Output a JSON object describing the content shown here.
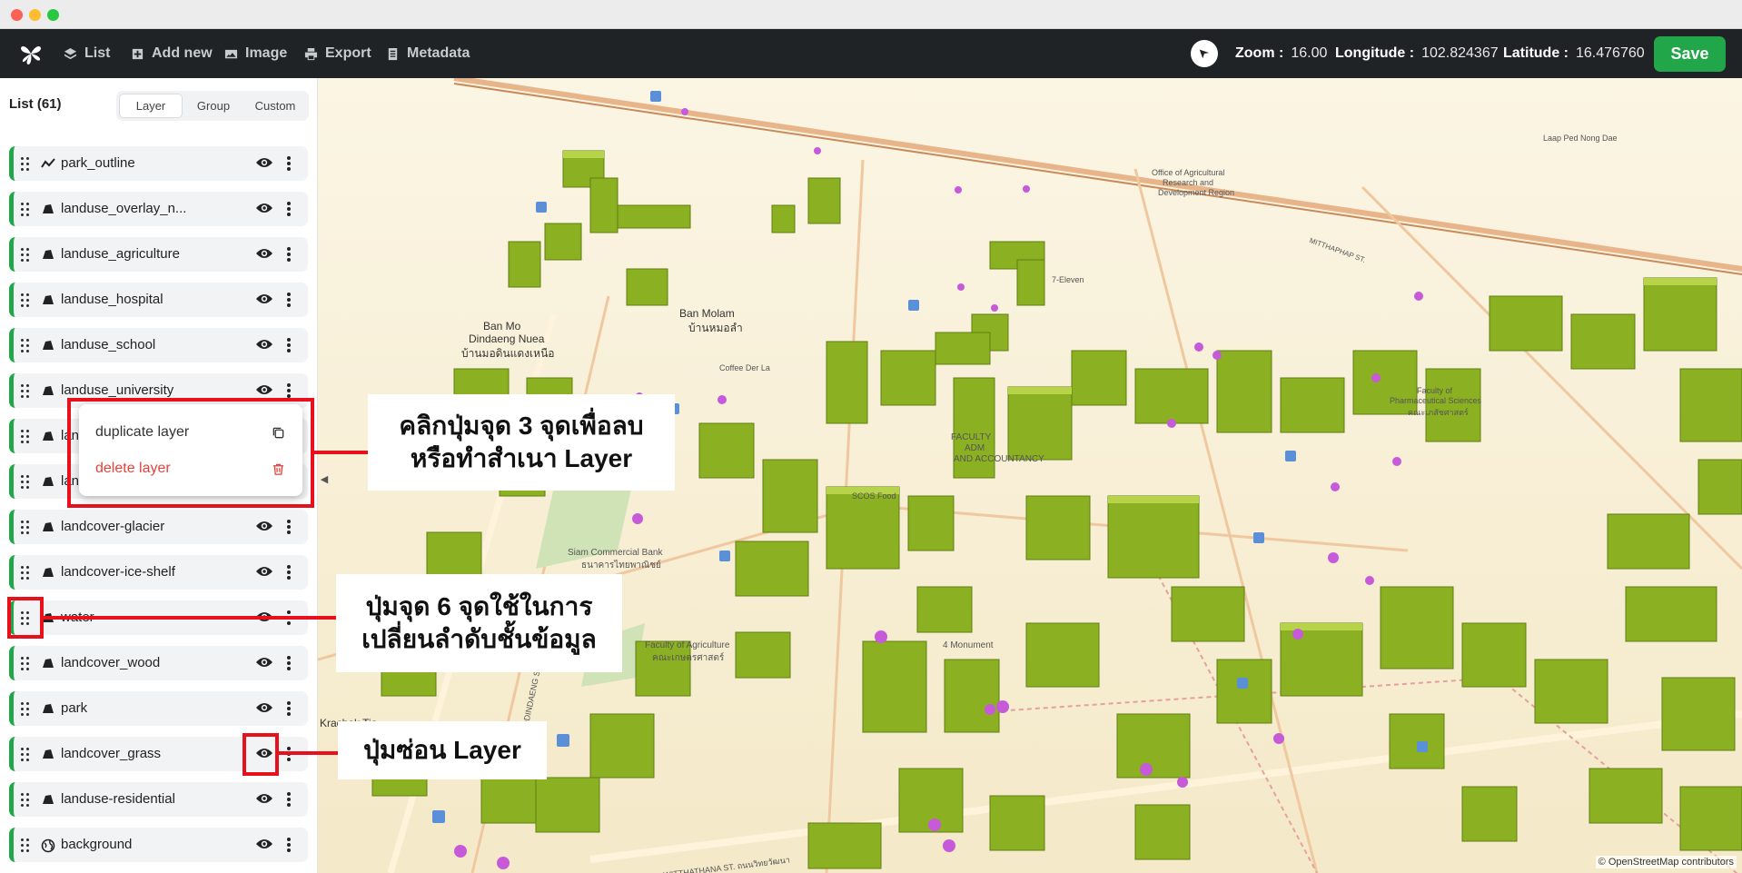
{
  "window": {
    "controls": [
      "close",
      "minimize",
      "maximize"
    ]
  },
  "toolbar": {
    "logo_icon": "leaf-logo-icon",
    "items": [
      {
        "label": "List",
        "icon": "layers-icon"
      },
      {
        "label": "Add new",
        "icon": "plus-square-icon"
      },
      {
        "label": "Image",
        "icon": "image-icon"
      },
      {
        "label": "Export",
        "icon": "printer-icon"
      },
      {
        "label": "Metadata",
        "icon": "document-icon"
      }
    ],
    "zoom_label": "Zoom :",
    "zoom_value": "16.00",
    "longitude_label": "Longitude :",
    "longitude_value": "102.824367",
    "latitude_label": "Latitude :",
    "latitude_value": "16.476760",
    "save_label": "Save"
  },
  "sidebar": {
    "title": "List (61)",
    "tabs": [
      "Layer",
      "Group",
      "Custom"
    ],
    "active_tab": "Layer",
    "layers": [
      {
        "name": "park_outline",
        "type": "line"
      },
      {
        "name": "landuse_overlay_n...",
        "type": "fill"
      },
      {
        "name": "landuse_agriculture",
        "type": "fill"
      },
      {
        "name": "landuse_hospital",
        "type": "fill"
      },
      {
        "name": "landuse_school",
        "type": "fill"
      },
      {
        "name": "landuse_university",
        "type": "fill"
      },
      {
        "name": "lan",
        "type": "fill"
      },
      {
        "name": "lan",
        "type": "fill"
      },
      {
        "name": "landcover-glacier",
        "type": "fill"
      },
      {
        "name": "landcover-ice-shelf",
        "type": "fill"
      },
      {
        "name": "water",
        "type": "fill"
      },
      {
        "name": "landcover_wood",
        "type": "fill"
      },
      {
        "name": "park",
        "type": "fill"
      },
      {
        "name": "landcover_grass",
        "type": "fill"
      },
      {
        "name": "landuse-residential",
        "type": "fill"
      },
      {
        "name": "background",
        "type": "globe"
      }
    ]
  },
  "context_menu": {
    "duplicate_label": "duplicate layer",
    "delete_label": "delete layer"
  },
  "annotations": {
    "menu_line1": "คลิกปุ่มจุด 3 จุดเพื่อลบ",
    "menu_line2": "หรือทำสำเนา Layer",
    "grip_line1": "ปุ่มจุด 6 จุดใช้ในการ",
    "grip_line2": "เปลี่ยนลำดับชั้นข้อมูล",
    "eye_line1": "ปุ่มซ่อน Layer"
  },
  "map": {
    "attribution": "© OpenStreetMap contributors",
    "labels": [
      "Ban Mo",
      "Dindaeng Nuea",
      "บ้านมอดินแดงเหนือ",
      "Ban Molam",
      "บ้านหมอลำ",
      "Siam Commercial Bank",
      "ธนาคารไทยพาณิชย์",
      "Faculty of Agriculture",
      "คณะเกษตรศาสตร์",
      "Faculty of",
      "Pharmaceutical Sciences",
      "คณะเภสัชศาสตร์",
      "Office of Agricultural",
      "Research and",
      "Development Region",
      "FACULTY",
      "ADM",
      "AND ACCOUNTANCY",
      "4 Monument",
      "MODINDAENG ST. ถนนมอดินแดง",
      "MITTHAPHAP ST.",
      "WITTHATHANA ST. ถนนวิทยวัฒนา",
      "7-Eleven",
      "Coffee Der La",
      "SCOS Food",
      "Laap Ped Nong Dae",
      "Krachak Tia"
    ]
  }
}
